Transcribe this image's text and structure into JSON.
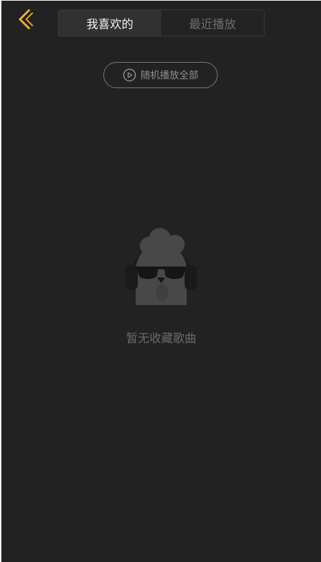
{
  "header": {
    "back_icon": "chevron-left-icon",
    "accent_color": "#f0b429"
  },
  "tabs": [
    {
      "label": "我喜欢的",
      "active": true
    },
    {
      "label": "最近播放",
      "active": false
    }
  ],
  "shuffle_button": {
    "icon": "play-circle-icon",
    "label": "随机播放全部"
  },
  "empty_state": {
    "illustration": "chicken-with-sunglasses-headphones-icon",
    "message": "暂无收藏歌曲"
  },
  "colors": {
    "background": "#222222",
    "tab_active_bg": "#313131",
    "tab_active_text": "#f2f2f2",
    "tab_inactive_text": "#6e6e6e",
    "muted_text": "#6a6a6a"
  }
}
